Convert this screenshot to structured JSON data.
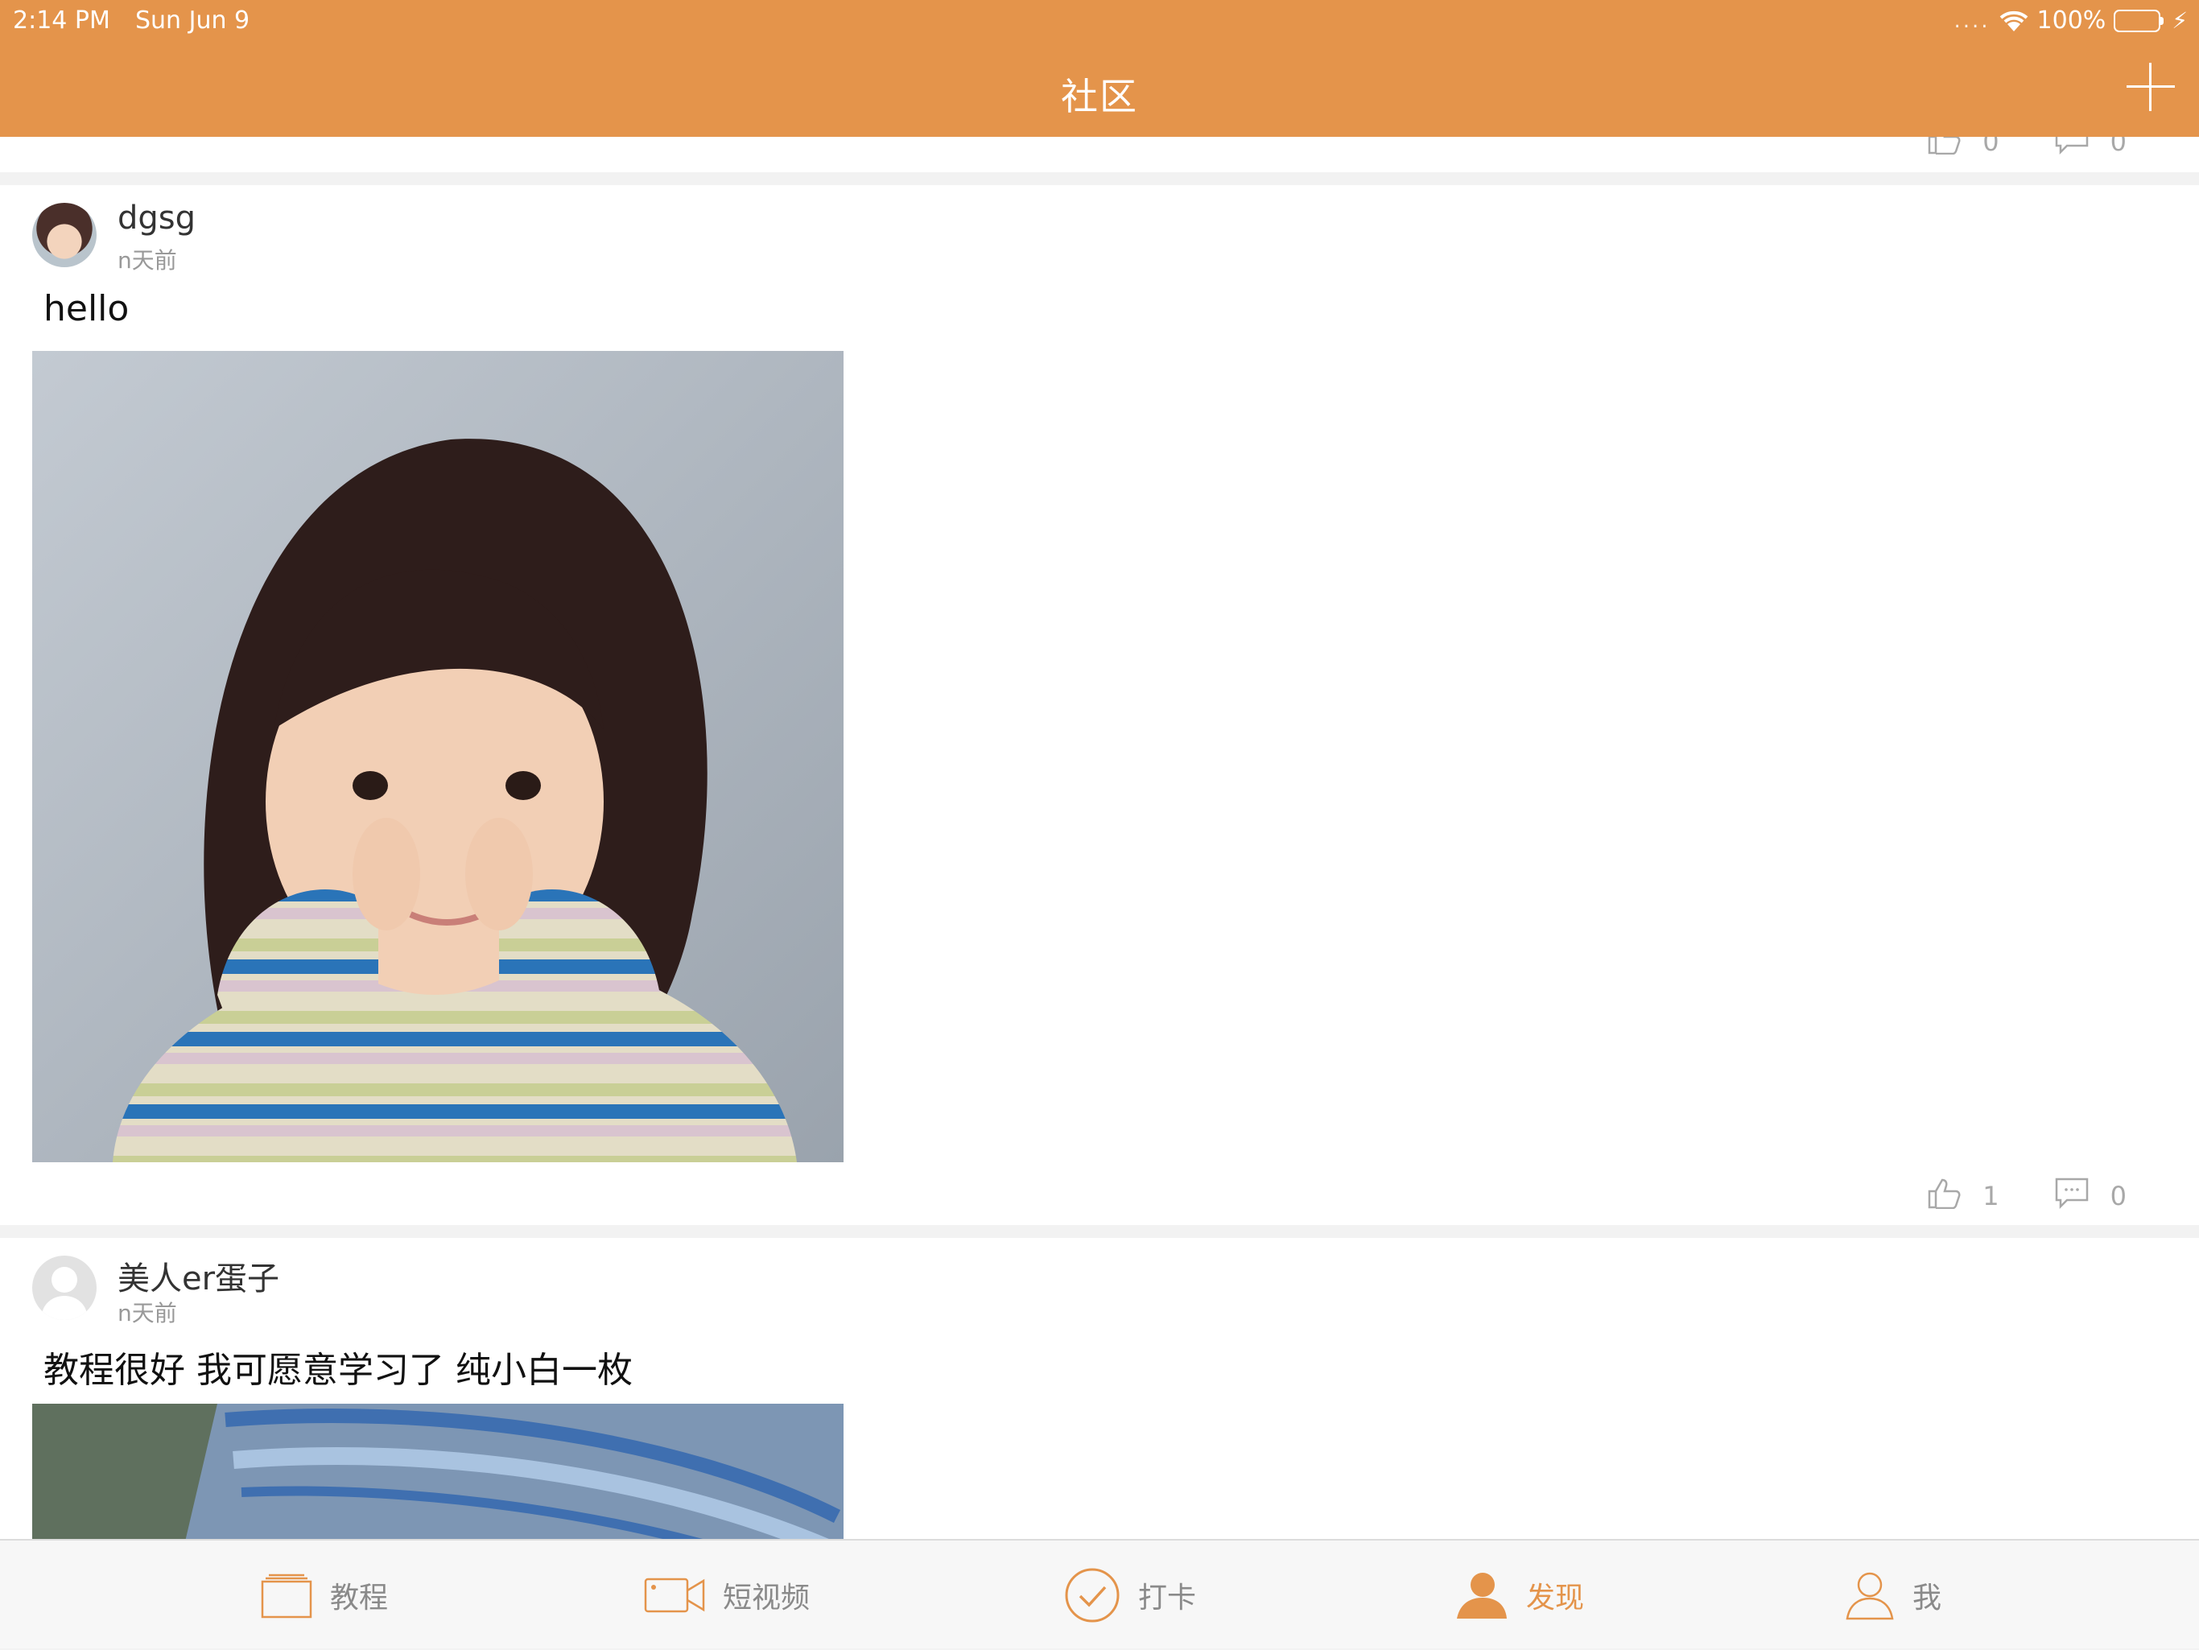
{
  "status_bar": {
    "time": "2:14 PM",
    "date": "Sun Jun 9",
    "signal": "....",
    "battery": "100%"
  },
  "nav": {
    "title": "社区"
  },
  "posts": [
    {
      "likes": "0",
      "comments": "0"
    },
    {
      "username": "dgsg",
      "time_ago": "n天前",
      "text": "hello",
      "likes": "1",
      "comments": "0"
    },
    {
      "username": "美人er蛋子",
      "time_ago": "n天前",
      "text": "教程很好 我可愿意学习了 纯小白一枚"
    }
  ],
  "tabs": [
    {
      "label": "教程",
      "icon": "tutorial-icon",
      "active": false
    },
    {
      "label": "短视频",
      "icon": "video-camera-icon",
      "active": false
    },
    {
      "label": "打卡",
      "icon": "checkmark-circle-icon",
      "active": false
    },
    {
      "label": "发现",
      "icon": "discover-person-icon",
      "active": true
    },
    {
      "label": "我",
      "icon": "profile-icon",
      "active": false
    }
  ],
  "colors": {
    "accent": "#e4944b",
    "inactive": "#8a8a8a",
    "battery": "#5fdc4f"
  }
}
